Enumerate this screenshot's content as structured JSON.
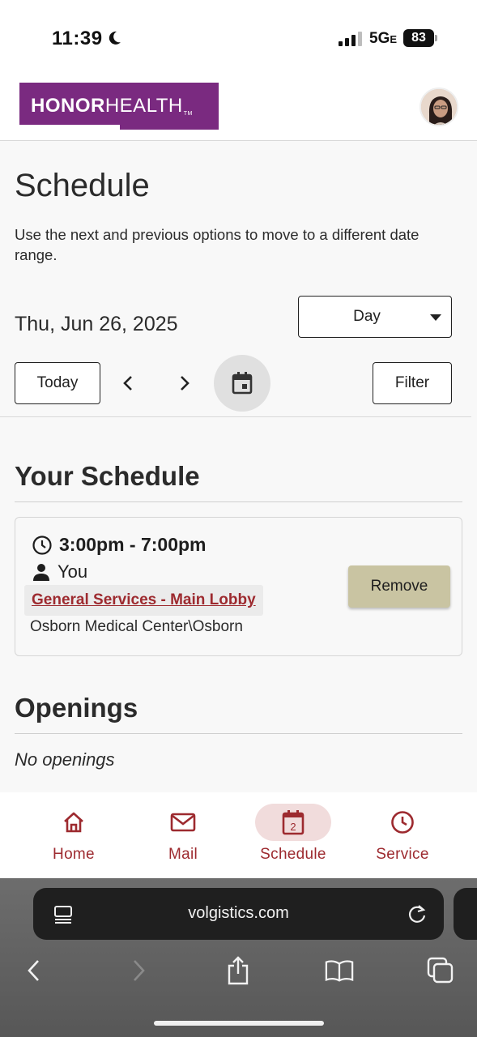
{
  "status_bar": {
    "time": "11:39",
    "network": "5G",
    "network_suffix": "E",
    "battery": "83"
  },
  "header": {
    "logo_bold": "HONOR",
    "logo_light": "HEALTH",
    "logo_tm": "TM"
  },
  "page": {
    "title": "Schedule",
    "help_text": "Use the next and previous options to move to a different date range.",
    "date": "Thu, Jun 26, 2025",
    "view_select": "Day",
    "today_label": "Today",
    "filter_label": "Filter"
  },
  "your_schedule": {
    "title": "Your Schedule",
    "shift": {
      "time": "3:00pm - 7:00pm",
      "who": "You",
      "location": "General Services - Main Lobby",
      "facility": "Osborn Medical Center\\Osborn",
      "remove_label": "Remove"
    }
  },
  "openings": {
    "title": "Openings",
    "empty_text": "No openings"
  },
  "bottom_nav": {
    "items": [
      {
        "label": "Home",
        "icon": "home-icon"
      },
      {
        "label": "Mail",
        "icon": "mail-icon"
      },
      {
        "label": "Schedule",
        "icon": "calendar-icon",
        "badge": "2"
      },
      {
        "label": "Service",
        "icon": "clock-icon"
      }
    ]
  },
  "browser": {
    "url": "volgistics.com"
  },
  "colors": {
    "brand_purple": "#7a2a80",
    "accent_red": "#9d2a2f",
    "remove_button": "#c9c4a2",
    "active_nav_bg": "#f1dcdc"
  }
}
